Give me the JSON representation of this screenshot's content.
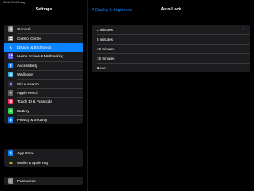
{
  "status_bar": {
    "text": "12:18  Wed 2 Aug"
  },
  "sidebar": {
    "title": "Settings",
    "group1": [
      {
        "label": "General",
        "icon": "gear-icon",
        "color": "#8e8e93"
      },
      {
        "label": "Control Centre",
        "icon": "toggles-icon",
        "color": "#8e8e93"
      },
      {
        "label": "Display & Brightness",
        "icon": "aa-icon",
        "color": "#0a84ff",
        "selected": true
      },
      {
        "label": "Home Screen & Multitasking",
        "icon": "grid-icon",
        "color": "#5e5ce6"
      },
      {
        "label": "Accessibility",
        "icon": "accessibility-icon",
        "color": "#0a84ff"
      },
      {
        "label": "Wallpaper",
        "icon": "flower-icon",
        "color": "#32ade6"
      },
      {
        "label": "Siri & Search",
        "icon": "siri-icon",
        "color": "#2c2c2e"
      },
      {
        "label": "Apple Pencil",
        "icon": "pencil-icon",
        "color": "#636366"
      },
      {
        "label": "Touch ID & Passcode",
        "icon": "fingerprint-icon",
        "color": "#ff375f"
      },
      {
        "label": "Battery",
        "icon": "battery-icon",
        "color": "#30d158"
      },
      {
        "label": "Privacy & Security",
        "icon": "hand-icon",
        "color": "#0a84ff"
      }
    ],
    "group2": [
      {
        "label": "App Store",
        "icon": "app-store-icon",
        "color": "#0a84ff"
      },
      {
        "label": "Wallet & Apple Pay",
        "icon": "wallet-icon",
        "color": "#1c1c1e"
      }
    ],
    "group3": [
      {
        "label": "Passwords",
        "icon": "key-icon",
        "color": "#8e8e93"
      }
    ]
  },
  "detail": {
    "back_label": "Display & Brightness",
    "title": "Auto-Lock",
    "options": [
      {
        "label": "2 minutes",
        "checked": true
      },
      {
        "label": "5 minutes",
        "checked": false
      },
      {
        "label": "10 minutes",
        "checked": false
      },
      {
        "label": "15 minutes",
        "checked": false
      },
      {
        "label": "Never",
        "checked": false
      }
    ],
    "check_glyph": "✓"
  }
}
